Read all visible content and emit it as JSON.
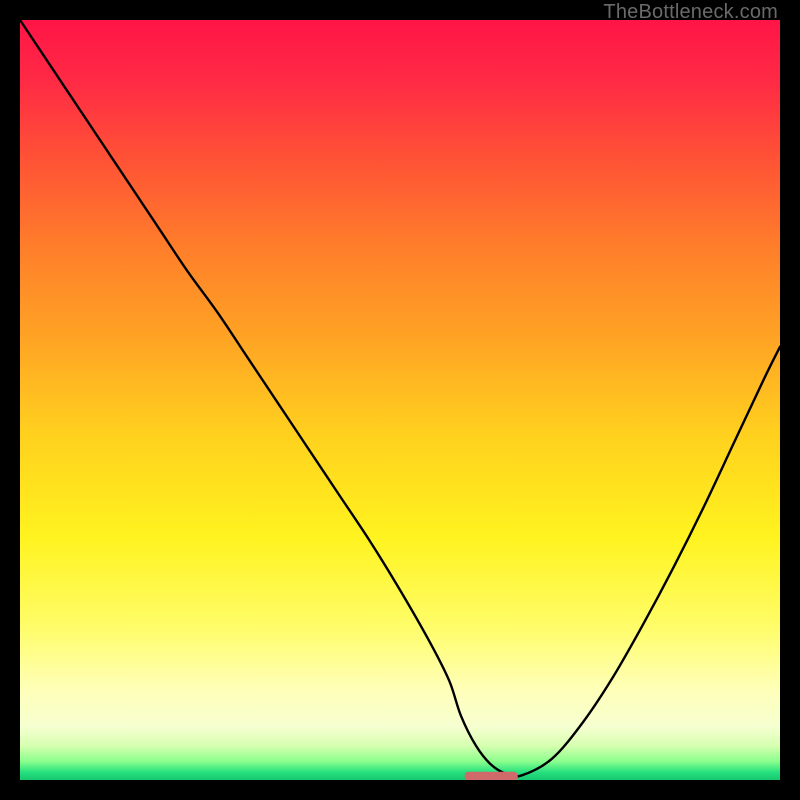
{
  "watermark": "TheBottleneck.com",
  "chart_data": {
    "type": "line",
    "title": "",
    "xlabel": "",
    "ylabel": "",
    "xlim": [
      0,
      100
    ],
    "ylim": [
      0,
      100
    ],
    "gradient_stops": [
      {
        "offset": 0.0,
        "color": "#ff1547"
      },
      {
        "offset": 0.08,
        "color": "#ff2a45"
      },
      {
        "offset": 0.18,
        "color": "#ff5136"
      },
      {
        "offset": 0.3,
        "color": "#ff7e2a"
      },
      {
        "offset": 0.42,
        "color": "#ffa424"
      },
      {
        "offset": 0.55,
        "color": "#ffd21e"
      },
      {
        "offset": 0.68,
        "color": "#fff31f"
      },
      {
        "offset": 0.8,
        "color": "#fffd6a"
      },
      {
        "offset": 0.88,
        "color": "#ffffb8"
      },
      {
        "offset": 0.93,
        "color": "#f6ffd0"
      },
      {
        "offset": 0.955,
        "color": "#d6ffb0"
      },
      {
        "offset": 0.975,
        "color": "#8eff8e"
      },
      {
        "offset": 0.99,
        "color": "#25e07e"
      },
      {
        "offset": 1.0,
        "color": "#17c76f"
      }
    ],
    "series": [
      {
        "name": "bottleneck-curve",
        "x": [
          0,
          6,
          12,
          18,
          22,
          26,
          30,
          34,
          38,
          42,
          46,
          50,
          54,
          56.5,
          58,
          60,
          62,
          64,
          66,
          70,
          74,
          78,
          82,
          86,
          90,
          94,
          98,
          100
        ],
        "y": [
          100,
          91,
          82,
          73,
          67,
          61.5,
          55.5,
          49.5,
          43.5,
          37.5,
          31.5,
          25,
          18,
          13,
          8.5,
          4.5,
          2,
          0.8,
          0.6,
          2.8,
          7.5,
          13.5,
          20.5,
          28,
          36,
          44.5,
          53,
          57
        ]
      }
    ],
    "marker": {
      "name": "optimal-point",
      "x_start": 58.5,
      "x_end": 65.5,
      "y": 0.5,
      "color": "#d06a6a"
    }
  }
}
